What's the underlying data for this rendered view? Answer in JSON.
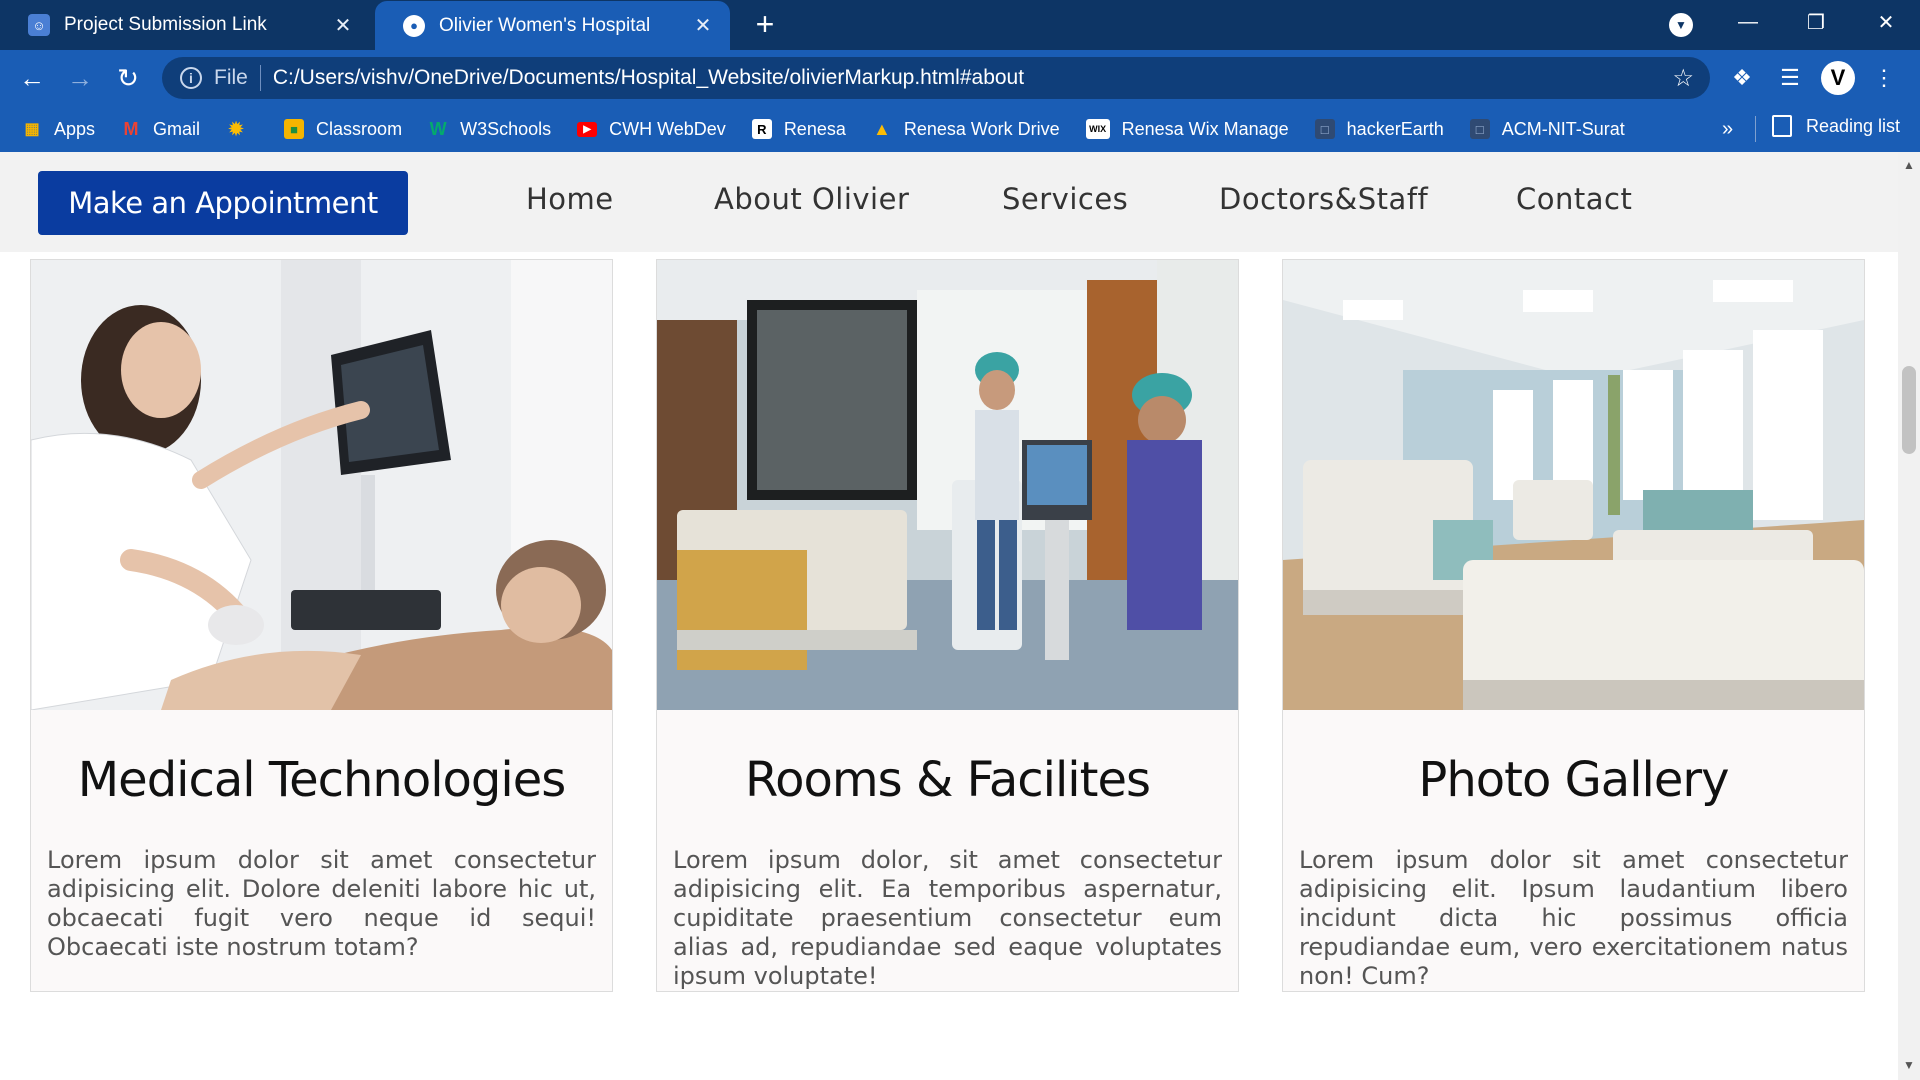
{
  "browser": {
    "tabs": [
      {
        "title": "Project Submission Link",
        "active": false
      },
      {
        "title": "Olivier Women's Hospital",
        "active": true
      }
    ],
    "address_bar": {
      "scheme_label": "File",
      "url": "C:/Users/vishv/OneDrive/Documents/Hospital_Website/olivierMarkup.html#about"
    },
    "profile_initial": "V",
    "bookmarks": [
      {
        "label": "Apps",
        "icon": "apps-grid-icon"
      },
      {
        "label": "Gmail",
        "icon": "gmail-icon"
      },
      {
        "label": "",
        "icon": "photos-pinwheel-icon"
      },
      {
        "label": "Classroom",
        "icon": "classroom-icon"
      },
      {
        "label": "W3Schools",
        "icon": "w3schools-icon"
      },
      {
        "label": "CWH WebDev",
        "icon": "youtube-icon"
      },
      {
        "label": "Renesa",
        "icon": "renesa-icon"
      },
      {
        "label": "Renesa Work Drive",
        "icon": "drive-icon"
      },
      {
        "label": "Renesa Wix Manage",
        "icon": "wix-icon"
      },
      {
        "label": "hackerEarth",
        "icon": "bookmark-page-icon"
      },
      {
        "label": "ACM-NIT-Surat",
        "icon": "bookmark-page-icon"
      }
    ],
    "bookmarks_overflow": "»",
    "reading_list": "Reading list",
    "accent_color": "#1a5db5",
    "frame_color": "#0d3565"
  },
  "site": {
    "appointment_button": "Make an Appointment",
    "nav": [
      "Home",
      "About Olivier",
      "Services",
      "Doctors&Staff",
      "Contact"
    ],
    "brand_color": "#0a3ca0",
    "cards": [
      {
        "image": "ultrasound-scan-photo",
        "title": "Medical Technologies",
        "text": "Lorem ipsum dolor sit amet consectetur adipisicing elit. Dolore deleniti labore hic ut, obcaecati fugit vero neque id sequi! Obcaecati iste nostrum totam?"
      },
      {
        "image": "hospital-room-staff-photo",
        "title": "Rooms & Facilites",
        "text": "Lorem ipsum dolor, sit amet consectetur adipisicing elit. Ea temporibus aspernatur, cupiditate praesentium consectetur eum alias ad, repudiandae sed eaque voluptates ipsum voluptate!"
      },
      {
        "image": "hospital-ward-photo",
        "title": "Photo Gallery",
        "text": "Lorem ipsum dolor sit amet consectetur adipisicing elit. Ipsum laudantium libero incidunt dicta hic possimus officia repudiandae eum, vero exercitationem natus non! Cum?"
      }
    ]
  }
}
